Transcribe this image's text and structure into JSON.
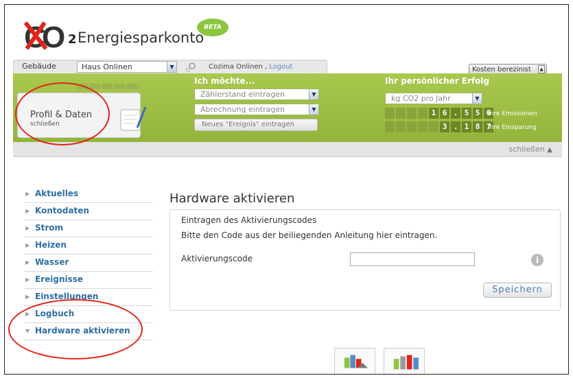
{
  "logo": {
    "sub": "2",
    "brand": "Energiesparkonto",
    "badge": "BETA"
  },
  "topbar": {
    "building_label": "Gebäude",
    "building_value": "Haus Onlinen",
    "user": "Cozima Onlinen ,",
    "logout": "Logout",
    "kosten": "Kosten berezinist"
  },
  "profile": {
    "title": "Profil & Daten",
    "close": "schließen"
  },
  "want": {
    "heading": "Ich möchte...",
    "option1": "Zählerstand eintragen",
    "option2": "Abrechnung eintragen",
    "event_button": "Neues \"Ereignis\" eintragen"
  },
  "success": {
    "heading": "Ihr persönlicher Erfolg",
    "unit": "kg CO2 pro Jahr",
    "emissions_digits": [
      "1",
      "6",
      ".",
      "5",
      "5",
      "6"
    ],
    "emissions_label": "Ihre Emissionen",
    "savings_digits": [
      "3",
      ".",
      "1",
      "8",
      "7"
    ],
    "savings_label": "Ihre Einsparung"
  },
  "band_close": "schließen",
  "sidebar": {
    "items": [
      {
        "label": "Aktuelles"
      },
      {
        "label": "Kontodaten"
      },
      {
        "label": "Strom"
      },
      {
        "label": "Heizen"
      },
      {
        "label": "Wasser"
      },
      {
        "label": "Ereignisse"
      },
      {
        "label": "Einstellungen"
      },
      {
        "label": "Logbuch"
      },
      {
        "label": "Hardware aktivieren"
      }
    ]
  },
  "main": {
    "title": "Hardware aktivieren",
    "panel_heading": "Eintragen des Aktivierungscodes",
    "panel_desc": "Bitte den Code aus der beiliegenden Anleitung hier eintragen.",
    "field_label": "Aktivierungscode",
    "field_value": "",
    "save": "Speichern",
    "info_icon": "i"
  },
  "colors": {
    "band": "#a9c84e",
    "link": "#2e6fa7",
    "highlight_ring": "#e2231a"
  }
}
